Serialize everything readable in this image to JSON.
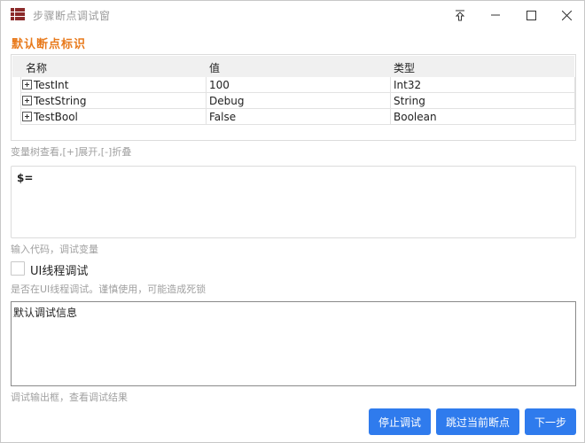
{
  "window": {
    "title": "步骤断点调试窗",
    "icon": "grid-app-icon",
    "controls": [
      "pin-icon",
      "minimize-icon",
      "maximize-icon",
      "close-icon"
    ]
  },
  "section_title": "默认断点标识",
  "grid": {
    "columns": [
      "名称",
      "值",
      "类型"
    ],
    "rows": [
      {
        "name": "TestInt",
        "value": "100",
        "type": "Int32"
      },
      {
        "name": "TestString",
        "value": "Debug",
        "type": "String"
      },
      {
        "name": "TestBool",
        "value": "False",
        "type": "Boolean"
      }
    ]
  },
  "grid_hint": "变量树查看,[+]展开,[-]折叠",
  "code": {
    "value": "$=",
    "hint": "输入代码，调试变量"
  },
  "ui_thread": {
    "label": "UI线程调试",
    "checked": false,
    "hint": "是否在UI线程调试。谨慎使用，可能造成死锁"
  },
  "output": {
    "value": "默认调试信息",
    "hint": "调试输出框，查看调试结果"
  },
  "buttons": {
    "stop": "停止调试",
    "skip": "跳过当前断点",
    "next": "下一步"
  },
  "colors": {
    "accent": "#2f7bed",
    "section_title": "#e87a1c",
    "app_icon": "#8b2a2a"
  }
}
